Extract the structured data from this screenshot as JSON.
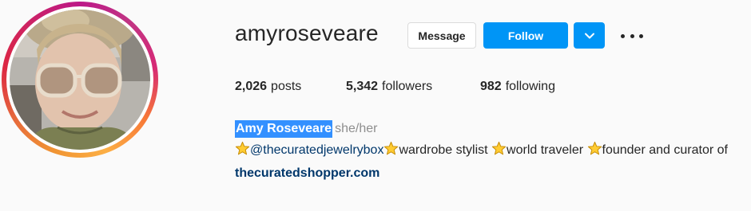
{
  "profile": {
    "username": "amyroseveare",
    "full_name": "Amy Roseveare",
    "pronouns": "she/her"
  },
  "actions": {
    "message_label": "Message",
    "follow_label": "Follow",
    "dropdown_icon": "chevron-down-icon",
    "more_icon": "more-options-icon"
  },
  "stats": {
    "posts": {
      "count": "2,026",
      "label": "posts"
    },
    "followers": {
      "count": "5,342",
      "label": "followers"
    },
    "following": {
      "count": "982",
      "label": "following"
    }
  },
  "bio": {
    "star_icon": "star-emoji",
    "mention": "@thecuratedjewelrybox",
    "part_1": "wardrobe stylist ",
    "part_2": "world traveler ",
    "part_3": "founder and curator of",
    "link": "thecuratedshopper.com"
  },
  "colors": {
    "follow_blue": "#0095f6",
    "link_dark_blue": "#00376b",
    "selection_highlight": "#3390ff",
    "secondary_text": "#8e8e8e"
  }
}
